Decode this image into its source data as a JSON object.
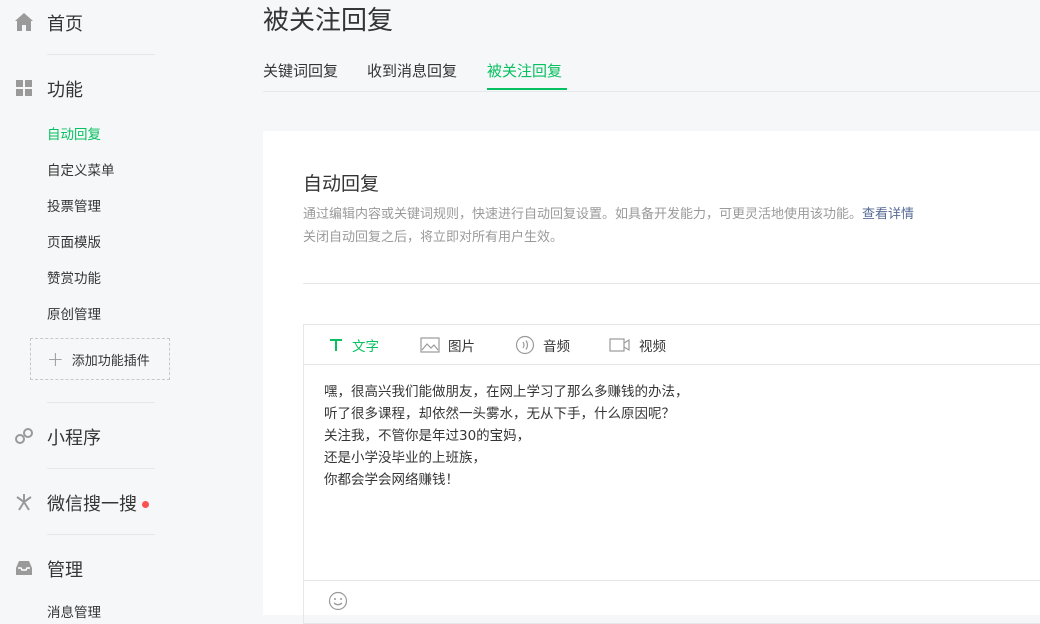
{
  "sidebar": {
    "home": {
      "label": "首页",
      "icon": "home-icon"
    },
    "features": {
      "label": "功能",
      "icon": "grid-icon",
      "items": [
        {
          "label": "自动回复",
          "active": true
        },
        {
          "label": "自定义菜单"
        },
        {
          "label": "投票管理"
        },
        {
          "label": "页面模版"
        },
        {
          "label": "赞赏功能"
        },
        {
          "label": "原创管理"
        }
      ],
      "add_plugin": "添加功能插件"
    },
    "mini_program": {
      "label": "小程序",
      "icon": "link-icon"
    },
    "wechat_search": {
      "label": "微信搜一搜",
      "icon": "search-spark-icon",
      "badge_color": "#fa5151"
    },
    "manage": {
      "label": "管理",
      "icon": "inbox-icon",
      "items": [
        {
          "label": "消息管理"
        }
      ]
    }
  },
  "header": {
    "title": "被关注回复",
    "tabs": [
      {
        "label": "关键词回复"
      },
      {
        "label": "收到消息回复"
      },
      {
        "label": "被关注回复",
        "active": true
      }
    ]
  },
  "main": {
    "section_title": "自动回复",
    "description_line1": "通过编辑内容或关键词规则，快速进行自动回复设置。如具备开发能力，可更灵活地使用该功能。",
    "description_link": "查看详情",
    "description_line2": "关闭自动回复之后，将立即对所有用户生效。",
    "editor": {
      "toolbar": [
        {
          "label": "文字",
          "icon": "text-icon",
          "active": true
        },
        {
          "label": "图片",
          "icon": "image-icon"
        },
        {
          "label": "音频",
          "icon": "audio-icon"
        },
        {
          "label": "视频",
          "icon": "video-icon"
        }
      ],
      "content_lines": [
        "嘿，很高兴我们能做朋友，在网上学习了那么多赚钱的办法，",
        "听了很多课程，却依然一头雾水，无从下手，什么原因呢？",
        "关注我，不管你是年过30的宝妈，",
        "还是小学没毕业的上班族，",
        "你都会学会网络赚钱！"
      ]
    }
  },
  "colors": {
    "accent": "#07c160",
    "link": "#576b95",
    "muted": "#9a9a9a"
  }
}
